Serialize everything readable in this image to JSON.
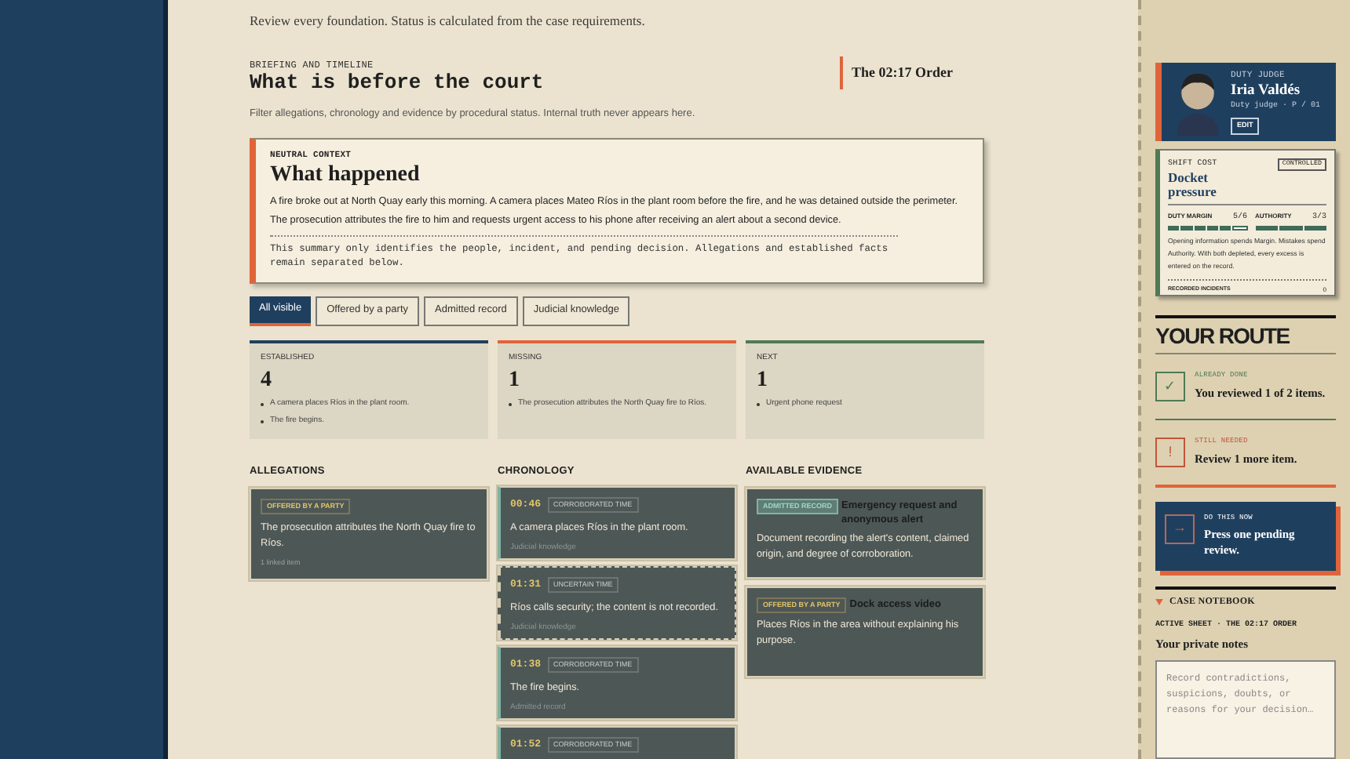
{
  "intro": "Review every foundation. Status is calculated from the case requirements.",
  "header": {
    "eyebrow": "BRIEFING AND TIMELINE",
    "title": "What is before the court",
    "subtitle": "Filter allegations, chronology and evidence by procedural status. Internal truth never appears here.",
    "case_badge": "The 02:17 Order"
  },
  "context": {
    "eyebrow": "NEUTRAL CONTEXT",
    "title": "What happened",
    "body": "A fire broke out at North Quay early this morning. A camera places Mateo Ríos in the plant room before the fire, and he was detained outside the perimeter. The prosecution attributes the fire to him and requests urgent access to his phone after receiving an alert about a second device.",
    "note": "This summary only identifies the people, incident, and pending decision. Allegations and established facts remain separated below."
  },
  "filters": [
    {
      "label": "All visible",
      "selected": true
    },
    {
      "label": "Offered by a party",
      "selected": false
    },
    {
      "label": "Admitted record",
      "selected": false
    },
    {
      "label": "Judicial knowledge",
      "selected": false
    }
  ],
  "summary": [
    {
      "label": "ESTABLISHED",
      "count": "4",
      "color": "#1f3f5f",
      "items": [
        "A camera places Ríos in the plant room.",
        "The fire begins."
      ]
    },
    {
      "label": "MISSING",
      "count": "1",
      "color": "#e0643a",
      "items": [
        "The prosecution attributes the North Quay fire to Ríos."
      ]
    },
    {
      "label": "NEXT",
      "count": "1",
      "color": "#4f7a55",
      "items": [
        "Urgent phone request"
      ]
    }
  ],
  "allegations": {
    "title": "ALLEGATIONS",
    "cards": [
      {
        "tag": "OFFERED BY A PARTY",
        "text": "The prosecution attributes the North Quay fire to Ríos.",
        "meta": "1 linked item"
      }
    ]
  },
  "chronology": {
    "title": "CHRONOLOGY",
    "events": [
      {
        "time": "00:46",
        "tag": "CORROBORATED TIME",
        "certain": true,
        "text": "A camera places Ríos in the plant room.",
        "meta": "Judicial knowledge"
      },
      {
        "time": "01:31",
        "tag": "UNCERTAIN TIME",
        "certain": false,
        "text": "Ríos calls security; the content is not recorded.",
        "meta": "Judicial knowledge"
      },
      {
        "time": "01:38",
        "tag": "CORROBORATED TIME",
        "certain": true,
        "text": "The fire begins.",
        "meta": "Admitted record"
      },
      {
        "time": "01:52",
        "tag": "CORROBORATED TIME",
        "certain": true
      }
    ]
  },
  "evidence": {
    "title": "AVAILABLE EVIDENCE",
    "items": [
      {
        "tag": "ADMITTED RECORD",
        "kind": "admitted",
        "title": "Emergency request and anonymous alert",
        "text": "Document recording the alert's content, claimed origin, and degree of corroboration."
      },
      {
        "tag": "OFFERED BY A PARTY",
        "kind": "offered",
        "title": "Dock access video",
        "text": "Places Ríos in the area without explaining his purpose."
      }
    ]
  },
  "judge": {
    "eyebrow": "DUTY JUDGE",
    "name": "Iria Valdés",
    "role": "Duty judge · P / 01",
    "edit": "EDIT"
  },
  "shift_cost": {
    "eyebrow": "SHIFT COST",
    "title": "Docket pressure",
    "badge": "CONTROLLED",
    "meters": [
      {
        "label": "DUTY MARGIN",
        "reading": "5/6",
        "cells": [
          {
            "filled": true
          },
          {
            "filled": true
          },
          {
            "filled": true
          },
          {
            "filled": true
          },
          {
            "filled": true
          },
          {
            "filled": false
          }
        ]
      },
      {
        "label": "AUTHORITY",
        "reading": "3/3",
        "cells": [
          {
            "filled": true
          },
          {
            "filled": true
          },
          {
            "filled": true
          }
        ]
      }
    ],
    "description": "Opening information spends Margin. Mistakes spend Authority. With both depleted, every excess is entered on the record.",
    "footer_label": "RECORDED INCIDENTS",
    "footer_value": "0"
  },
  "route": {
    "title": "YOUR ROUTE",
    "steps": [
      {
        "kind": "done",
        "icon": "✓",
        "eyebrow": "ALREADY DONE",
        "text": "You reviewed 1 of 2 items."
      },
      {
        "kind": "needed",
        "icon": "!",
        "eyebrow": "STILL NEEDED",
        "text": "Review 1 more item."
      },
      {
        "kind": "now",
        "icon": "→",
        "eyebrow": "DO THIS NOW",
        "text": "Press one pending review."
      }
    ]
  },
  "notebook": {
    "title": "CASE NOTEBOOK",
    "expanded": true,
    "sheet": "ACTIVE SHEET · THE 02:17 ORDER",
    "heading": "Your private notes",
    "placeholder": "Record contradictions, suspicions, doubts, or reasons for your decision…"
  }
}
